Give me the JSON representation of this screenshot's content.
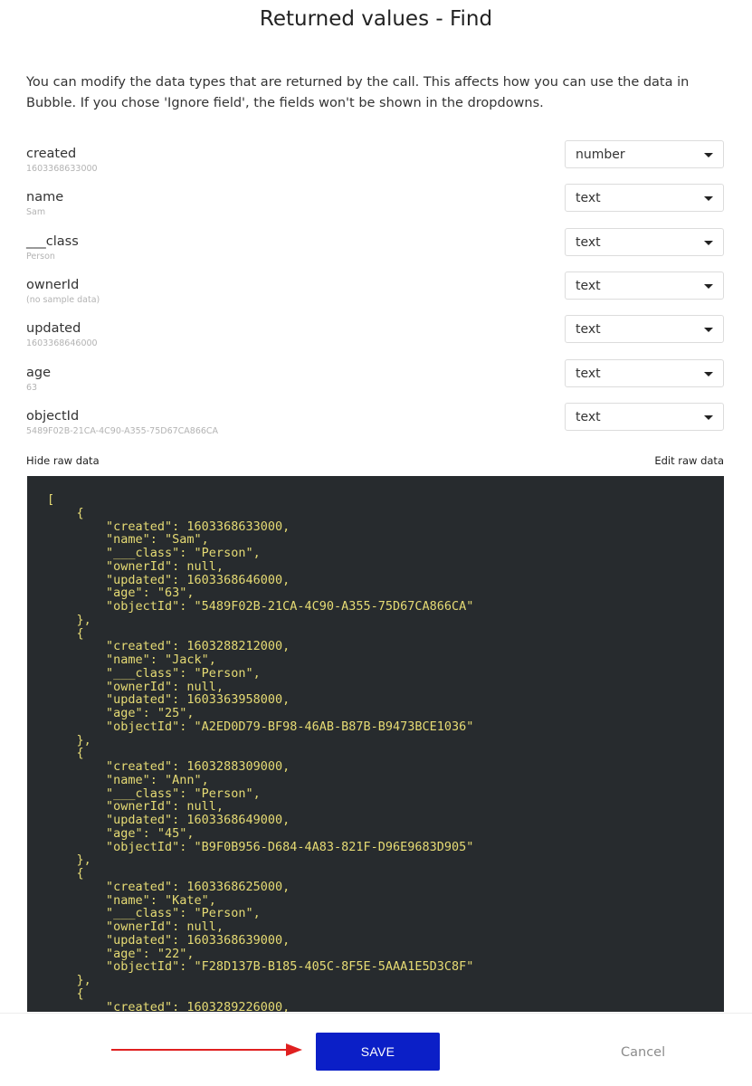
{
  "dialog": {
    "title": "Returned values - Find",
    "description": "You can modify the data types that are returned by the call. This affects how you can use the data in Bubble. If you chose 'Ignore field', the fields won't be shown in the dropdowns."
  },
  "fields": [
    {
      "name": "created",
      "sample": "1603368633000",
      "type": "number"
    },
    {
      "name": "name",
      "sample": "Sam",
      "type": "text"
    },
    {
      "name": "___class",
      "sample": "Person",
      "type": "text"
    },
    {
      "name": "ownerId",
      "sample": "(no sample data)",
      "type": "text"
    },
    {
      "name": "updated",
      "sample": "1603368646000",
      "type": "text"
    },
    {
      "name": "age",
      "sample": "63",
      "type": "text"
    },
    {
      "name": "objectId",
      "sample": "5489F02B-21CA-4C90-A355-75D67CA866CA",
      "type": "text"
    }
  ],
  "raw_data": {
    "hide_label": "Hide raw data",
    "edit_label": "Edit raw data",
    "text": "[\n    {\n        \"created\": 1603368633000,\n        \"name\": \"Sam\",\n        \"___class\": \"Person\",\n        \"ownerId\": null,\n        \"updated\": 1603368646000,\n        \"age\": \"63\",\n        \"objectId\": \"5489F02B-21CA-4C90-A355-75D67CA866CA\"\n    },\n    {\n        \"created\": 1603288212000,\n        \"name\": \"Jack\",\n        \"___class\": \"Person\",\n        \"ownerId\": null,\n        \"updated\": 1603363958000,\n        \"age\": \"25\",\n        \"objectId\": \"A2ED0D79-BF98-46AB-B87B-B9473BCE1036\"\n    },\n    {\n        \"created\": 1603288309000,\n        \"name\": \"Ann\",\n        \"___class\": \"Person\",\n        \"ownerId\": null,\n        \"updated\": 1603368649000,\n        \"age\": \"45\",\n        \"objectId\": \"B9F0B956-D684-4A83-821F-D96E9683D905\"\n    },\n    {\n        \"created\": 1603368625000,\n        \"name\": \"Kate\",\n        \"___class\": \"Person\",\n        \"ownerId\": null,\n        \"updated\": 1603368639000,\n        \"age\": \"22\",\n        \"objectId\": \"F28D137B-B185-405C-8F5E-5AAA1E5D3C8F\"\n    },\n    {\n        \"created\": 1603289226000,"
  },
  "footer": {
    "save_label": "SAVE",
    "cancel_label": "Cancel"
  },
  "colors": {
    "save_button": "#0b1fc7",
    "code_background": "#272b2e",
    "code_text": "#e6db74",
    "annotation_arrow": "#e02020"
  }
}
